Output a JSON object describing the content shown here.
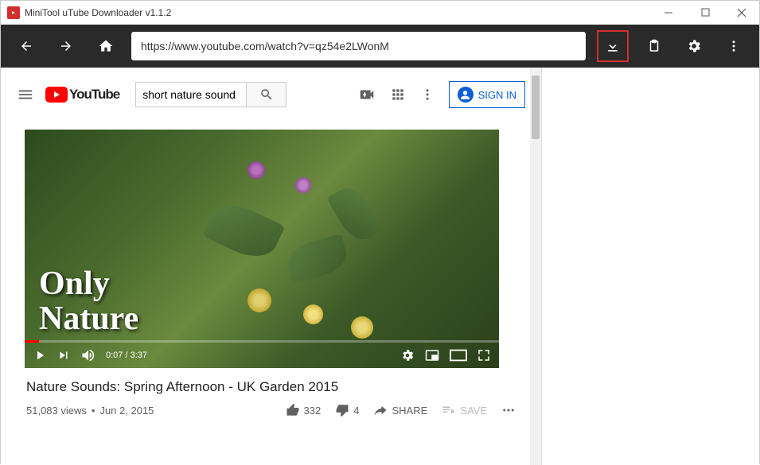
{
  "window": {
    "title": "MiniTool uTube Downloader v1.1.2"
  },
  "toolbar": {
    "url": "https://www.youtube.com/watch?v=qz54e2LWonM"
  },
  "youtube": {
    "brand": "YouTube",
    "search_value": "short nature sound",
    "signin": "SIGN IN"
  },
  "video": {
    "overlay_line1": "Only",
    "overlay_line2": "Nature",
    "time_current": "0:07",
    "time_total": "3:37",
    "title": "Nature Sounds: Spring Afternoon - UK Garden 2015",
    "views": "51,083 views",
    "date": "Jun 2, 2015",
    "likes": "332",
    "dislikes": "4",
    "share": "SHARE",
    "save": "SAVE"
  }
}
